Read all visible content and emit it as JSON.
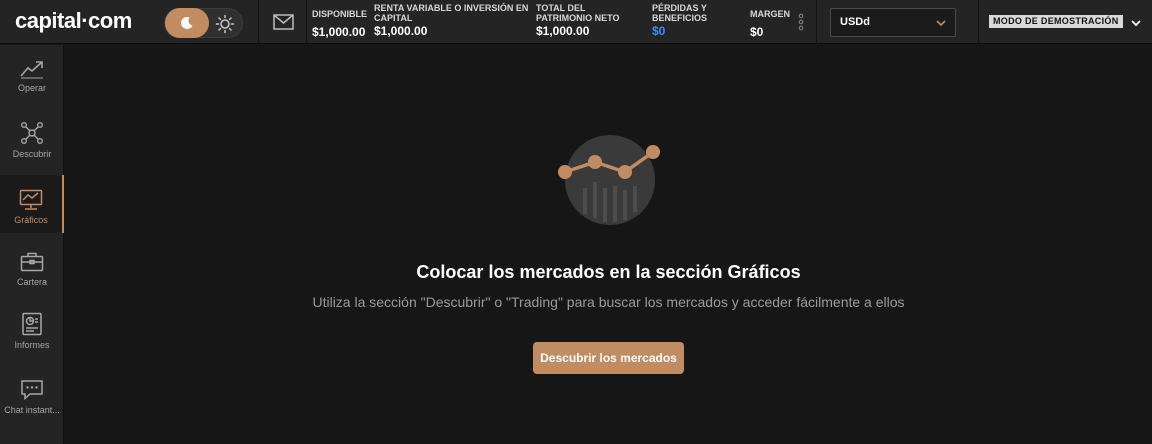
{
  "header": {
    "logo": "capital·com",
    "stats": [
      {
        "label_lines": [
          "DISPONIBLE"
        ],
        "value": "$1,000.00",
        "color": "#ffffff"
      },
      {
        "label_lines": [
          "RENTA VARIABLE O INVERSIÓN EN",
          "CAPITAL"
        ],
        "value": "$1,000.00",
        "color": "#ffffff"
      },
      {
        "label_lines": [
          "TOTAL DEL",
          "PATRIMONIO NETO"
        ],
        "value": "$1,000.00",
        "color": "#ffffff"
      },
      {
        "label_lines": [
          "PÉRDIDAS Y",
          "BENEFICIOS"
        ],
        "value": "$0",
        "color": "#3d8cff"
      },
      {
        "label_lines": [
          "MARGEN"
        ],
        "value": "$0",
        "color": "#ffffff"
      }
    ],
    "currency": "USDd",
    "mode_badge": "MODO DE DEMOSTRACIÓN"
  },
  "sidebar": {
    "items": [
      {
        "label": "Operar",
        "icon": "trend-up-icon"
      },
      {
        "label": "Descubrir",
        "icon": "network-icon"
      },
      {
        "label": "Gráficos",
        "icon": "monitor-chart-icon",
        "active": true
      },
      {
        "label": "Cartera",
        "icon": "briefcase-icon"
      },
      {
        "label": "Informes",
        "icon": "report-icon"
      },
      {
        "label": "Chat instant...",
        "icon": "chat-icon"
      }
    ]
  },
  "main": {
    "title": "Colocar los mercados en la sección Gráficos",
    "subtitle": "Utiliza la sección \"Descubrir\" o \"Trading\" para buscar los mercados y acceder fácilmente a ellos",
    "button": "Descubrir los mercados"
  },
  "colors": {
    "accent": "#c28c63",
    "positive_blue": "#3d8cff",
    "background": "#161616",
    "panel": "#242424"
  }
}
